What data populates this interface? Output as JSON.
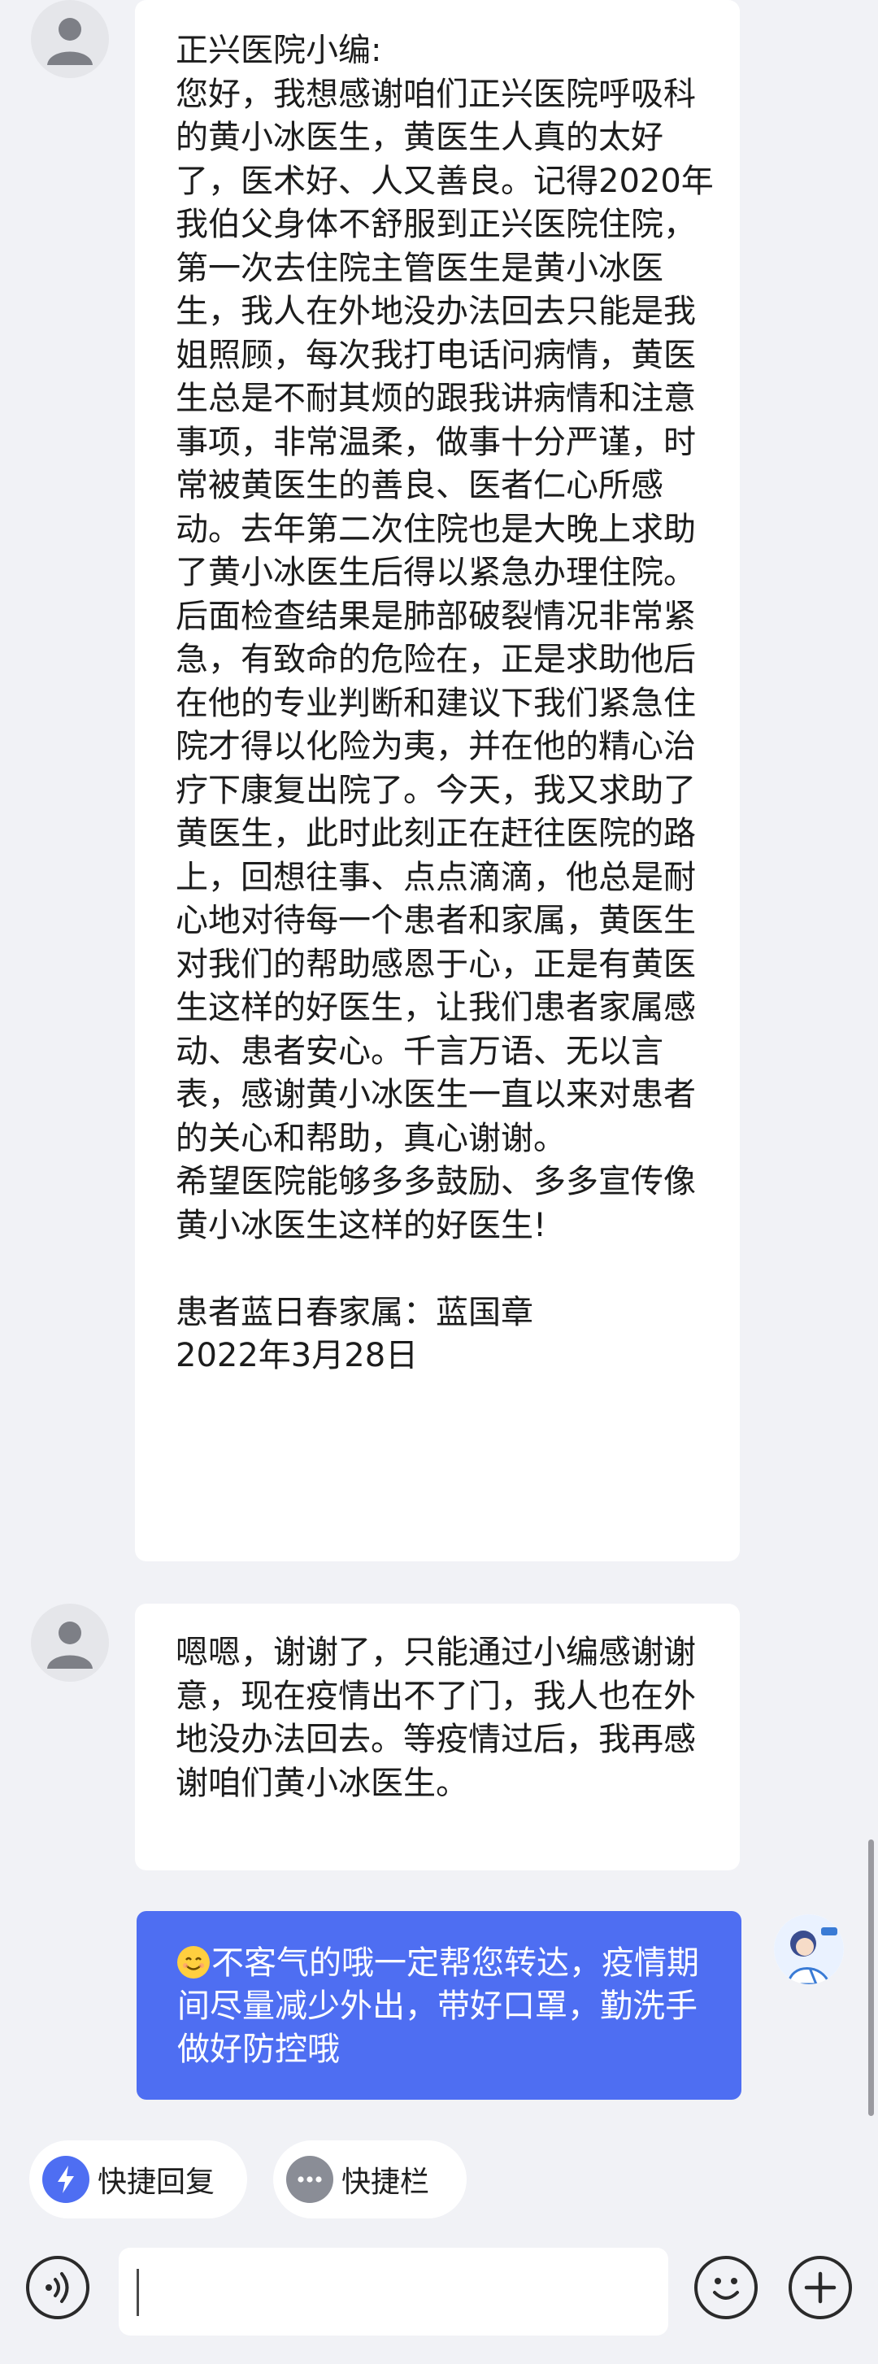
{
  "messages": [
    {
      "sender": "user",
      "text": "正兴医院小编:\n您好，我想感谢咱们正兴医院呼吸科的黄小冰医生，黄医生人真的太好了，医术好、人又善良。记得2020年我伯父身体不舒服到正兴医院住院，第一次去住院主管医生是黄小冰医生，我人在外地没办法回去只能是我姐照顾，每次我打电话问病情，黄医生总是不耐其烦的跟我讲病情和注意事项，非常温柔，做事十分严谨，时常被黄医生的善良、医者仁心所感动。去年第二次住院也是大晚上求助了黄小冰医生后得以紧急办理住院。后面检查结果是肺部破裂情况非常紧急，有致命的危险在，正是求助他后在他的专业判断和建议下我们紧急住院才得以化险为夷，并在他的精心治疗下康复出院了。今天，我又求助了黄医生，此时此刻正在赶往医院的路上，回想往事、点点滴滴，他总是耐心地对待每一个患者和家属，黄医生对我们的帮助感恩于心，正是有黄医生这样的好医生，让我们患者家属感动、患者安心。千言万语、无以言表，感谢黄小冰医生一直以来对患者的关心和帮助，真心谢谢。\n希望医院能够多多鼓励、多多宣传像黄小冰医生这样的好医生!\n\n患者蓝日春家属：蓝国章\n2022年3月28日"
    },
    {
      "sender": "user",
      "text": "嗯嗯，谢谢了，只能通过小编感谢谢意，现在疫情出不了门，我人也在外地没办法回去。等疫情过后，我再感谢咱们黄小冰医生。"
    },
    {
      "sender": "agent",
      "emoji": "smiling-face-icon",
      "text": "不客气的哦一定帮您转达，疫情期间尽量减少外出，带好口罩，勤洗手做好防控哦"
    }
  ],
  "quick_actions": {
    "reply_label": "快捷回复",
    "bar_label": "快捷栏"
  },
  "input": {
    "value": "",
    "placeholder": ""
  },
  "colors": {
    "background": "#f1f2f6",
    "agent_bubble": "#4e6ef2",
    "user_bubble": "#ffffff",
    "quick_reply_icon": "#4e6ef2",
    "quick_bar_icon": "#8a8d96"
  }
}
